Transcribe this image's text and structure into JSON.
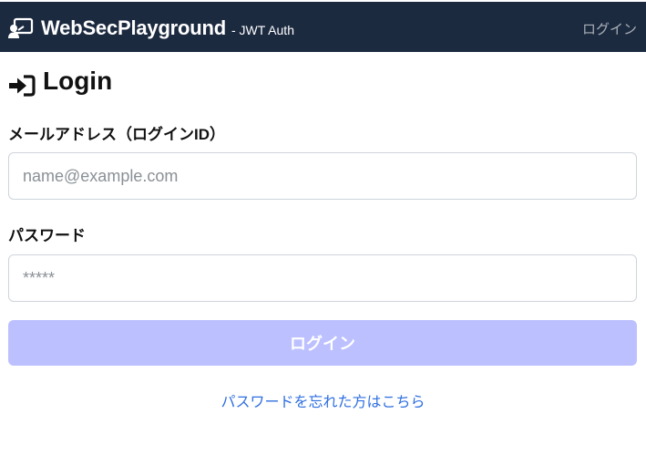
{
  "navbar": {
    "brand_name": "WebSecPlayground",
    "brand_sub": "- JWT Auth",
    "brand_icon": "presentation-user-icon",
    "login_link": "ログイン"
  },
  "page": {
    "title": "Login",
    "title_icon": "sign-in-icon"
  },
  "form": {
    "email_label": "メールアドレス（ログインID）",
    "email_placeholder": "name@example.com",
    "email_value": "",
    "password_label": "パスワード",
    "password_placeholder": "*****",
    "password_value": "",
    "submit_label": "ログイン",
    "submit_disabled": true,
    "forgot_link": "パスワードを忘れた方はこちら"
  },
  "colors": {
    "navbar_bg": "#1c2a40",
    "button_bg_disabled": "#bcc0ff",
    "link": "#2f6fe0"
  }
}
